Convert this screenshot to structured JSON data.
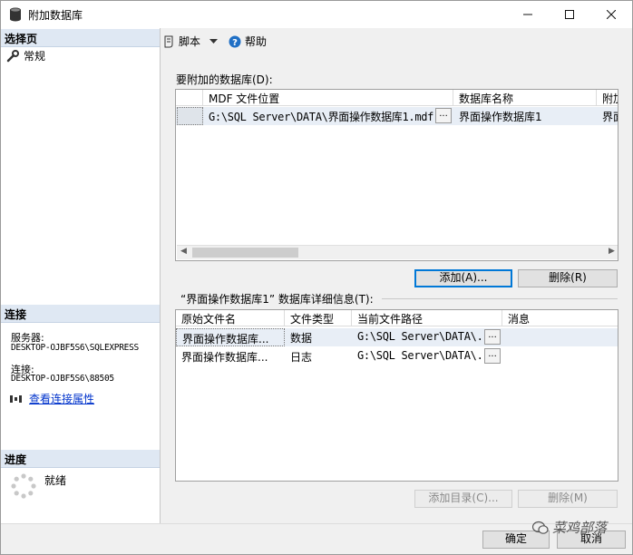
{
  "window": {
    "title": "附加数据库"
  },
  "left": {
    "select_page_header": "选择页",
    "page_general": "常规",
    "connection_header": "连接",
    "server_label": "服务器:",
    "server_value": "DESKTOP-OJBF5S6\\SQLEXPRESS",
    "connection_label": "连接:",
    "connection_value": "DESKTOP-OJBF5S6\\88505",
    "view_conn_props": "查看连接属性",
    "progress_header": "进度",
    "progress_status": "就绪"
  },
  "toolbar": {
    "script_label": "脚本",
    "help_label": "帮助"
  },
  "attach": {
    "label": "要附加的数据库(D):",
    "columns": [
      "MDF 文件位置",
      "数据库名称",
      "附加"
    ],
    "rows": [
      {
        "mdf": "G:\\SQL Server\\DATA\\界面操作数据库1.mdf",
        "name": "界面操作数据库1",
        "attach": "界面"
      }
    ],
    "add_button": "添加(A)...",
    "remove_button": "删除(R)"
  },
  "details": {
    "label": "“界面操作数据库1” 数据库详细信息(T):",
    "columns": [
      "原始文件名",
      "文件类型",
      "当前文件路径",
      "消息"
    ],
    "rows": [
      {
        "original": "界面操作数据库...",
        "type": "数据",
        "path": "G:\\SQL Server\\DATA\\...",
        "message": ""
      },
      {
        "original": "界面操作数据库...",
        "type": "日志",
        "path": "G:\\SQL Server\\DATA\\...",
        "message": ""
      }
    ],
    "add_catalog_button": "添加目录(C)...",
    "remove_button": "删除(M)"
  },
  "footer": {
    "ok_button": "确定",
    "cancel_button": "取消",
    "watermark": "菜鸡部落"
  }
}
